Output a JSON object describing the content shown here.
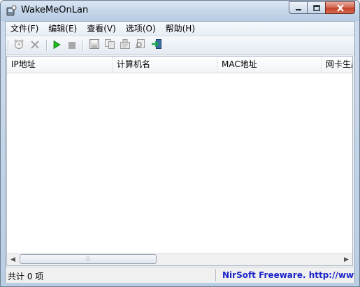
{
  "window": {
    "title": "WakeMeOnLan"
  },
  "menu": [
    {
      "label": "文件(F)"
    },
    {
      "label": "编辑(E)"
    },
    {
      "label": "查看(V)"
    },
    {
      "label": "选项(O)"
    },
    {
      "label": "帮助(H)"
    }
  ],
  "toolbar": {
    "buttons": [
      {
        "icon": "alarm-clock-icon",
        "enabled": false
      },
      {
        "icon": "delete-x-icon",
        "enabled": false
      },
      {
        "icon": "play-icon",
        "enabled": true
      },
      {
        "icon": "stop-icon",
        "enabled": false
      },
      {
        "icon": "save-icon",
        "enabled": false
      },
      {
        "icon": "copy-icon",
        "enabled": false
      },
      {
        "icon": "properties-icon",
        "enabled": false
      },
      {
        "icon": "find-icon",
        "enabled": false
      },
      {
        "icon": "exit-icon",
        "enabled": true
      }
    ]
  },
  "table": {
    "columns": [
      "IP地址",
      "计算机名",
      "MAC地址",
      "网卡生产"
    ],
    "rows": []
  },
  "status": {
    "count": "共计 0 项",
    "link": "NirSoft Freeware.  http://www.nirsof"
  },
  "colors": {
    "play": "#1fb81f",
    "status_link": "#1b25c8",
    "close_button": "#c8452c"
  }
}
